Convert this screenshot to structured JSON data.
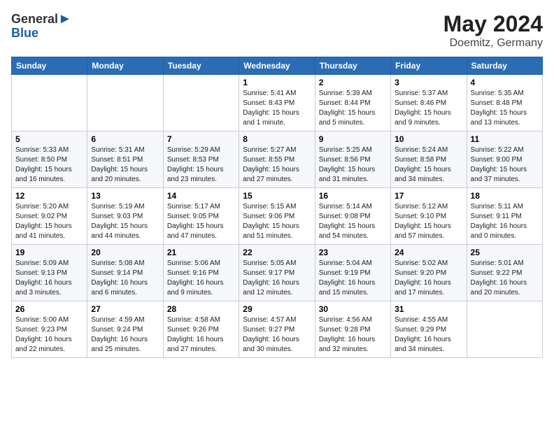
{
  "logo": {
    "general": "General",
    "blue": "Blue"
  },
  "title": {
    "month": "May 2024",
    "location": "Doemitz, Germany"
  },
  "weekdays": [
    "Sunday",
    "Monday",
    "Tuesday",
    "Wednesday",
    "Thursday",
    "Friday",
    "Saturday"
  ],
  "weeks": [
    [
      {
        "day": "",
        "info": ""
      },
      {
        "day": "",
        "info": ""
      },
      {
        "day": "",
        "info": ""
      },
      {
        "day": "1",
        "info": "Sunrise: 5:41 AM\nSunset: 8:43 PM\nDaylight: 15 hours\nand 1 minute."
      },
      {
        "day": "2",
        "info": "Sunrise: 5:39 AM\nSunset: 8:44 PM\nDaylight: 15 hours\nand 5 minutes."
      },
      {
        "day": "3",
        "info": "Sunrise: 5:37 AM\nSunset: 8:46 PM\nDaylight: 15 hours\nand 9 minutes."
      },
      {
        "day": "4",
        "info": "Sunrise: 5:35 AM\nSunset: 8:48 PM\nDaylight: 15 hours\nand 13 minutes."
      }
    ],
    [
      {
        "day": "5",
        "info": "Sunrise: 5:33 AM\nSunset: 8:50 PM\nDaylight: 15 hours\nand 16 minutes."
      },
      {
        "day": "6",
        "info": "Sunrise: 5:31 AM\nSunset: 8:51 PM\nDaylight: 15 hours\nand 20 minutes."
      },
      {
        "day": "7",
        "info": "Sunrise: 5:29 AM\nSunset: 8:53 PM\nDaylight: 15 hours\nand 23 minutes."
      },
      {
        "day": "8",
        "info": "Sunrise: 5:27 AM\nSunset: 8:55 PM\nDaylight: 15 hours\nand 27 minutes."
      },
      {
        "day": "9",
        "info": "Sunrise: 5:25 AM\nSunset: 8:56 PM\nDaylight: 15 hours\nand 31 minutes."
      },
      {
        "day": "10",
        "info": "Sunrise: 5:24 AM\nSunset: 8:58 PM\nDaylight: 15 hours\nand 34 minutes."
      },
      {
        "day": "11",
        "info": "Sunrise: 5:22 AM\nSunset: 9:00 PM\nDaylight: 15 hours\nand 37 minutes."
      }
    ],
    [
      {
        "day": "12",
        "info": "Sunrise: 5:20 AM\nSunset: 9:02 PM\nDaylight: 15 hours\nand 41 minutes."
      },
      {
        "day": "13",
        "info": "Sunrise: 5:19 AM\nSunset: 9:03 PM\nDaylight: 15 hours\nand 44 minutes."
      },
      {
        "day": "14",
        "info": "Sunrise: 5:17 AM\nSunset: 9:05 PM\nDaylight: 15 hours\nand 47 minutes."
      },
      {
        "day": "15",
        "info": "Sunrise: 5:15 AM\nSunset: 9:06 PM\nDaylight: 15 hours\nand 51 minutes."
      },
      {
        "day": "16",
        "info": "Sunrise: 5:14 AM\nSunset: 9:08 PM\nDaylight: 15 hours\nand 54 minutes."
      },
      {
        "day": "17",
        "info": "Sunrise: 5:12 AM\nSunset: 9:10 PM\nDaylight: 15 hours\nand 57 minutes."
      },
      {
        "day": "18",
        "info": "Sunrise: 5:11 AM\nSunset: 9:11 PM\nDaylight: 16 hours\nand 0 minutes."
      }
    ],
    [
      {
        "day": "19",
        "info": "Sunrise: 5:09 AM\nSunset: 9:13 PM\nDaylight: 16 hours\nand 3 minutes."
      },
      {
        "day": "20",
        "info": "Sunrise: 5:08 AM\nSunset: 9:14 PM\nDaylight: 16 hours\nand 6 minutes."
      },
      {
        "day": "21",
        "info": "Sunrise: 5:06 AM\nSunset: 9:16 PM\nDaylight: 16 hours\nand 9 minutes."
      },
      {
        "day": "22",
        "info": "Sunrise: 5:05 AM\nSunset: 9:17 PM\nDaylight: 16 hours\nand 12 minutes."
      },
      {
        "day": "23",
        "info": "Sunrise: 5:04 AM\nSunset: 9:19 PM\nDaylight: 16 hours\nand 15 minutes."
      },
      {
        "day": "24",
        "info": "Sunrise: 5:02 AM\nSunset: 9:20 PM\nDaylight: 16 hours\nand 17 minutes."
      },
      {
        "day": "25",
        "info": "Sunrise: 5:01 AM\nSunset: 9:22 PM\nDaylight: 16 hours\nand 20 minutes."
      }
    ],
    [
      {
        "day": "26",
        "info": "Sunrise: 5:00 AM\nSunset: 9:23 PM\nDaylight: 16 hours\nand 22 minutes."
      },
      {
        "day": "27",
        "info": "Sunrise: 4:59 AM\nSunset: 9:24 PM\nDaylight: 16 hours\nand 25 minutes."
      },
      {
        "day": "28",
        "info": "Sunrise: 4:58 AM\nSunset: 9:26 PM\nDaylight: 16 hours\nand 27 minutes."
      },
      {
        "day": "29",
        "info": "Sunrise: 4:57 AM\nSunset: 9:27 PM\nDaylight: 16 hours\nand 30 minutes."
      },
      {
        "day": "30",
        "info": "Sunrise: 4:56 AM\nSunset: 9:28 PM\nDaylight: 16 hours\nand 32 minutes."
      },
      {
        "day": "31",
        "info": "Sunrise: 4:55 AM\nSunset: 9:29 PM\nDaylight: 16 hours\nand 34 minutes."
      },
      {
        "day": "",
        "info": ""
      }
    ]
  ]
}
